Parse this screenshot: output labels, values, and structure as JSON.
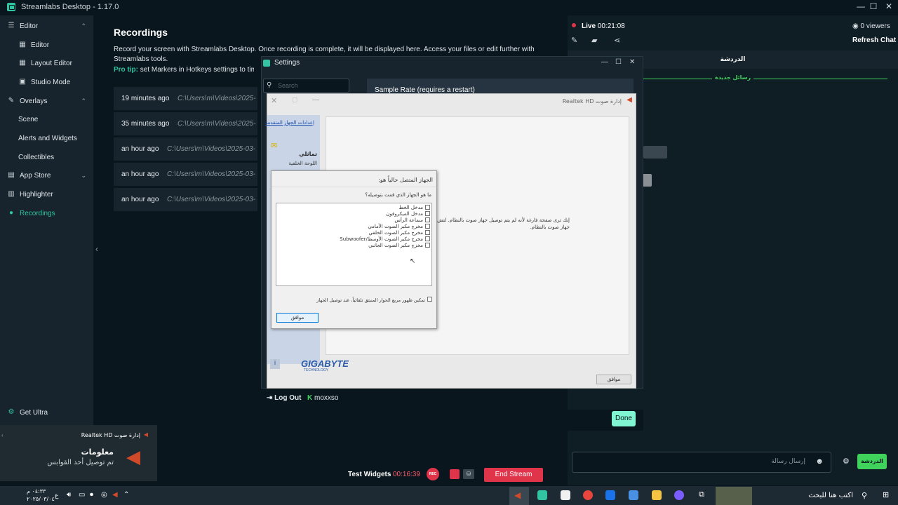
{
  "app": {
    "title": "Streamlabs Desktop - 1.17.0"
  },
  "nav": {
    "items": [
      {
        "label": "Editor",
        "icon": "sliders-icon"
      },
      {
        "label": "Editor",
        "icon": "grid-icon"
      },
      {
        "label": "Layout Editor",
        "icon": "layout-icon"
      },
      {
        "label": "Studio Mode",
        "icon": "studio-icon"
      },
      {
        "label": "Overlays",
        "icon": "palette-icon"
      },
      {
        "label": "Scene",
        "icon": ""
      },
      {
        "label": "Alerts and Widgets",
        "icon": ""
      },
      {
        "label": "Collectibles",
        "icon": ""
      },
      {
        "label": "App Store",
        "icon": "store-icon"
      },
      {
        "label": "Highlighter",
        "icon": "highlighter-icon"
      },
      {
        "label": "Recordings",
        "icon": "record-icon"
      }
    ],
    "get_ultra": "Get Ultra"
  },
  "recordings": {
    "title": "Recordings",
    "description": "Record your screen with Streamlabs Desktop. Once recording is complete, it will be displayed here. Access your files or edit further with Streamlabs tools.",
    "pro_tip_label": "Pro tip:",
    "pro_tip_text": "set Markers in Hotkeys settings to timest",
    "rows": [
      {
        "time": "19 minutes ago",
        "path": "C:\\Users\\m\\Videos\\2025-"
      },
      {
        "time": "35 minutes ago",
        "path": "C:\\Users\\m\\Videos\\2025-"
      },
      {
        "time": "an hour ago",
        "path": "C:\\Users\\m\\Videos\\2025-03-"
      },
      {
        "time": "an hour ago",
        "path": "C:\\Users\\m\\Videos\\2025-03-"
      },
      {
        "time": "an hour ago",
        "path": "C:\\Users\\m\\Videos\\2025-03-"
      }
    ]
  },
  "chat": {
    "live_label": "Live",
    "live_time": "00:21:08",
    "viewers": "0 viewers",
    "refresh": "Refresh Chat",
    "header": "الدردشة",
    "new_messages": "رسائل جديدة",
    "input_placeholder": "إرسال رسالة",
    "send_label": "الدردشة"
  },
  "settings": {
    "title": "Settings",
    "search_placeholder": "Search",
    "sample_rate": "Sample Rate (requires a restart)",
    "logout": "Log Out",
    "username": "moxxso",
    "done": "Done"
  },
  "realtek": {
    "title": "إدارة صوت Realtek HD",
    "advanced_link": "إعدادات الجهاز المتقدمة",
    "analog": "تماثلي",
    "back_panel": "اللوحة الخلفية",
    "info_text": "إنك ترى صفحة فارغة لأنه لم يتم توصيل جهاز صوت بالنظام. لتش توصيل جهاز صوت بالنظام.",
    "brand": "GIGABYTE",
    "brand_sub": "TECHNOLOGY",
    "ok": "موافق"
  },
  "dialog": {
    "title": "الجهاز المتصل حالياً هو:",
    "question": "ما هو الجهاز الذي قمت بتوصيله؟",
    "options": [
      {
        "label": "مدخل الخط",
        "checked": false
      },
      {
        "label": "مدخل الميكروفون",
        "checked": true
      },
      {
        "label": "سماعة الرأس",
        "checked": false
      },
      {
        "label": "مخرج مكبر الصوت الأمامي",
        "checked": false
      },
      {
        "label": "مخرج مكبر الصوت الخلفي",
        "checked": false
      },
      {
        "label": "مخرج مكبر الصوت الأوسط/Subwoofer",
        "checked": false
      },
      {
        "label": "مخرج مكبر الصوت الجانبي",
        "checked": false
      }
    ],
    "auto_popup": "تمكين ظهور مربع الحوار المنبثق تلقائياً، عند توصيل الجهاز",
    "auto_popup_checked": true,
    "ok": "موافق"
  },
  "bottom": {
    "test_widgets": "Test Widgets",
    "rec_time": "00:16:39",
    "rec_label": "REC",
    "end_stream": "End Stream"
  },
  "toast": {
    "app": "إدارة صوت Realtek HD",
    "title": "معلومات",
    "body": "تم توصيل أحد القوابس"
  },
  "taskbar": {
    "search_placeholder": "اكتب هنا للبحث",
    "time": "٠٤:٣٣ م",
    "date": "٢٠٢٥/٠٣/٠٤",
    "lang": "ع"
  },
  "colors": {
    "accent": "#31c3a2",
    "bg": "#09161d",
    "panel": "#17242d",
    "danger": "#e0344b"
  }
}
